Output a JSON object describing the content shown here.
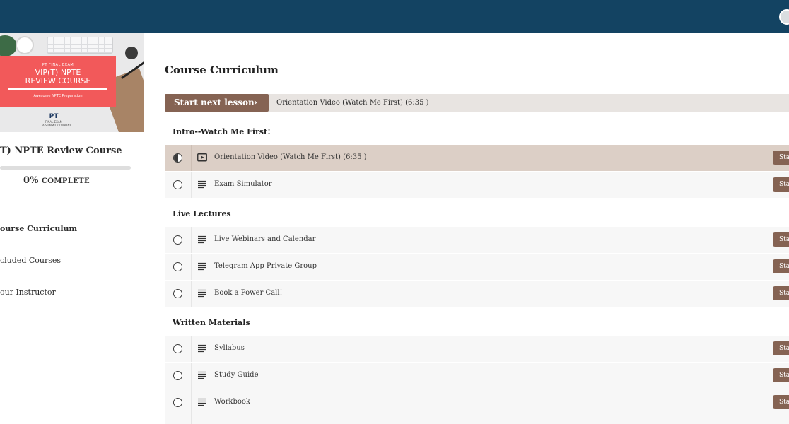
{
  "sidebar": {
    "course_image": {
      "banner_top": "PT FINAL EXAM",
      "banner_title_line1": "VIP(T) NPTE",
      "banner_title_line2": "REVIEW COURSE",
      "banner_subtitle": "Awesome NPTE Preparation",
      "logo_mark": "PT",
      "logo_line1": "FINAL EXAM",
      "logo_line2": "A SUMMIT COMPANY"
    },
    "course_title": "T) NPTE Review Course",
    "progress": {
      "percent": 0,
      "percent_label": "0%",
      "label": "COMPLETE"
    },
    "nav": [
      {
        "label": "ourse Curriculum",
        "active": true
      },
      {
        "label": "cluded Courses",
        "active": false
      },
      {
        "label": "our Instructor",
        "active": false
      }
    ]
  },
  "main": {
    "title": "Course Curriculum",
    "next": {
      "button_label": "Start next lesson",
      "chevron": "›",
      "lesson": "Orientation Video (Watch Me First) (6:35 )"
    },
    "sections": [
      {
        "title": "Intro--Watch Me First!",
        "lessons": [
          {
            "title": "Orientation Video (Watch Me First) (6:35 )",
            "icon": "video-icon",
            "status": "in-progress",
            "button": "Sta"
          },
          {
            "title": "Exam Simulator",
            "icon": "text-icon",
            "status": "not-started",
            "button": "Sta"
          }
        ]
      },
      {
        "title": "Live Lectures",
        "lessons": [
          {
            "title": "Live Webinars and Calendar",
            "icon": "text-icon",
            "status": "not-started",
            "button": "Sta"
          },
          {
            "title": "Telegram App Private Group",
            "icon": "text-icon",
            "status": "not-started",
            "button": "Sta"
          },
          {
            "title": "Book a Power Call!",
            "icon": "text-icon",
            "status": "not-started",
            "button": "Sta"
          }
        ]
      },
      {
        "title": "Written Materials",
        "lessons": [
          {
            "title": "Syllabus",
            "icon": "text-icon",
            "status": "not-started",
            "button": "Sta"
          },
          {
            "title": "Study Guide",
            "icon": "text-icon",
            "status": "not-started",
            "button": "Sta"
          },
          {
            "title": "Workbook",
            "icon": "text-icon",
            "status": "not-started",
            "button": "Sta"
          }
        ]
      }
    ]
  },
  "colors": {
    "header": "#134362",
    "accent": "#856353",
    "active_row": "#dccfc6",
    "banner": "#f2595a"
  }
}
